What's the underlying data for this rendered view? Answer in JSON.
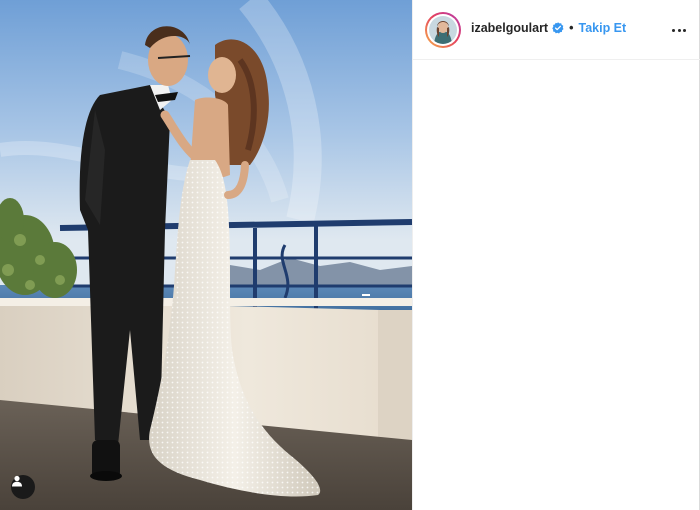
{
  "post": {
    "username": "izabelgoulart",
    "separator": "•",
    "follow_label": "Takip Et",
    "verified": true,
    "icons": {
      "verified": "verified-badge-icon",
      "more": "more-options-icon",
      "tag": "user-tag-icon"
    },
    "colors": {
      "follow": "#3897f0",
      "verified": "#3897f0",
      "username": "#262626"
    }
  }
}
